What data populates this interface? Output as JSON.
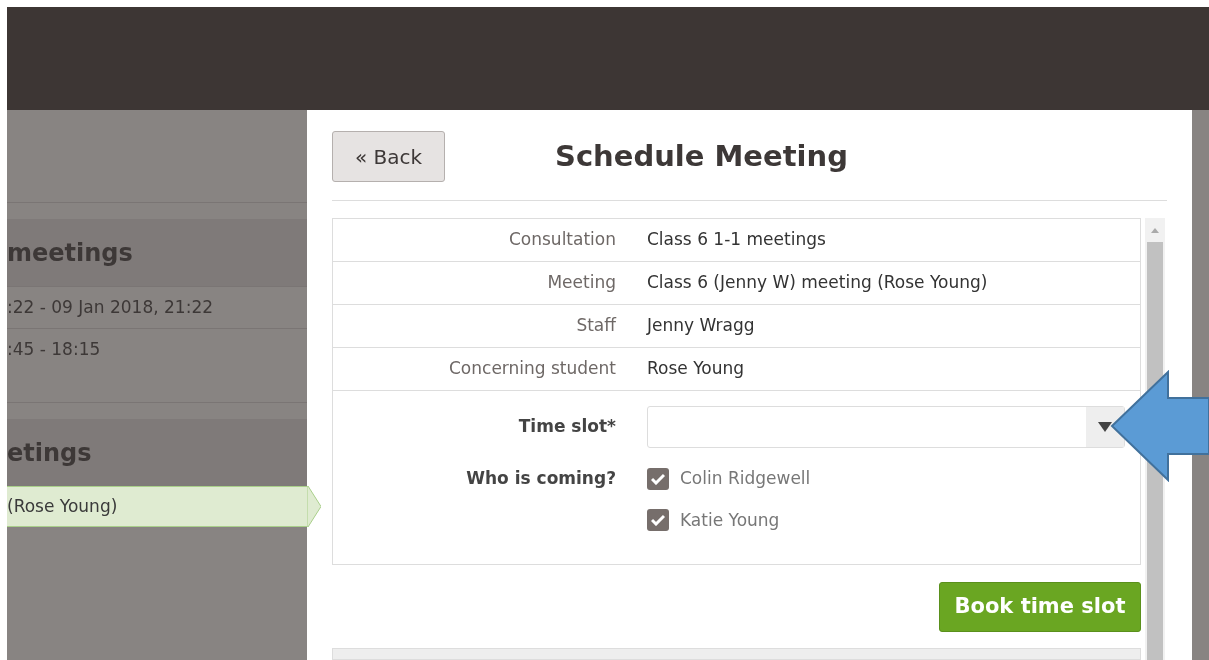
{
  "sidebar": {
    "sections": [
      {
        "heading": "meetings",
        "items": [
          {
            "text": ":22 - 09 Jan 2018, 21:22",
            "selected": false
          },
          {
            "text": ":45 - 18:15",
            "selected": false
          }
        ]
      },
      {
        "heading": "etings",
        "items": [
          {
            "text": "(Rose Young)",
            "selected": true
          }
        ]
      }
    ]
  },
  "dialog": {
    "back_button": "« Back",
    "title": "Schedule Meeting",
    "details": [
      {
        "label": "Consultation",
        "value": "Class 6 1-1 meetings"
      },
      {
        "label": "Meeting",
        "value": "Class 6 (Jenny W) meeting (Rose Young)"
      },
      {
        "label": "Staff",
        "value": "Jenny Wragg"
      },
      {
        "label": "Concerning student",
        "value": "Rose Young"
      }
    ],
    "time_slot": {
      "label": "Time slot*"
    },
    "attendees": {
      "label": "Who is coming?",
      "people": [
        {
          "name": "Colin Ridgewell",
          "checked": true
        },
        {
          "name": "Katie Young",
          "checked": true
        }
      ]
    },
    "submit_button": "Book time slot"
  }
}
